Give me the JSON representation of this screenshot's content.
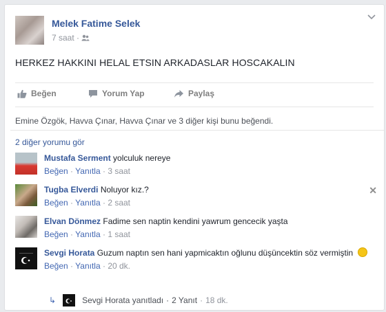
{
  "post": {
    "author": "Melek Fatime Selek",
    "time": "7 saat",
    "text": "HERKEZ HAKKINI HELAL ETSIN ARKADASLAR HOSCAKALIN"
  },
  "actions": {
    "like": "Beğen",
    "comment": "Yorum Yap",
    "share": "Paylaş"
  },
  "likes_summary": "Emine Özgök, Havva Çınar, Havva Çınar ve 3 diğer kişi bunu beğendi.",
  "more_comments": "2 diğer yorumu gör",
  "comments": [
    {
      "name": "Mustafa Serment",
      "text": "yolculuk nereye",
      "like": "Beğen",
      "reply": "Yanıtla",
      "time": "3 saat"
    },
    {
      "name": "Tugba Elverdi",
      "text": "Noluyor kız.?",
      "like": "Beğen",
      "reply": "Yanıtla",
      "time": "2 saat"
    },
    {
      "name": "Elvan Dönmez",
      "text": "Fadime sen naptin kendini yawrum gencecik yaşta",
      "like": "Beğen",
      "reply": "Yanıtla",
      "time": "1 saat"
    },
    {
      "name": "Sevgi Horata",
      "text": "Guzum naptın sen hani yapmicaktın oğlunu düşüncektin söz vermiştin",
      "like": "Beğen",
      "reply": "Yanıtla",
      "time": "20 dk."
    }
  ],
  "reply_thread": {
    "text": "Sevgi Horata yanıtladı",
    "count": "2 Yanıt",
    "time": "18 dk."
  },
  "meta_separator": "·",
  "icons": {
    "audience": "friends-icon",
    "like": "thumbs-up-icon",
    "comment": "comment-bubble-icon",
    "share": "share-arrow-icon",
    "menu": "chevron-down-icon",
    "close": "close-icon",
    "reply": "reply-arrow-icon"
  },
  "colors": {
    "link": "#365899",
    "muted": "#90949c",
    "background": "#e9ebee"
  }
}
